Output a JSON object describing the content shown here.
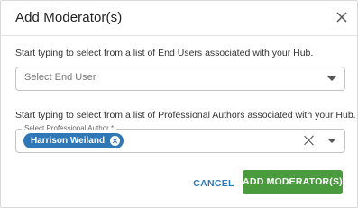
{
  "dialog": {
    "title": "Add Moderator(s)",
    "close_icon": "close-icon"
  },
  "end_users": {
    "hint": "Start typing to select from a list of End Users associated with your Hub.",
    "placeholder": "Select End User",
    "caret_icon": "chevron-down-icon"
  },
  "authors": {
    "hint": "Start typing to select from a list of Professional Authors associated with your Hub.",
    "label": "Select Professional Author *",
    "selected": [
      {
        "name": "Harrison Weiland"
      }
    ],
    "clear_icon": "close-icon",
    "caret_icon": "chevron-down-icon"
  },
  "actions": {
    "cancel_label": "CANCEL",
    "submit_label": "ADD MODERATOR(S)"
  },
  "colors": {
    "accent": "#2f78b7",
    "primary_button": "#4a9a3e"
  }
}
